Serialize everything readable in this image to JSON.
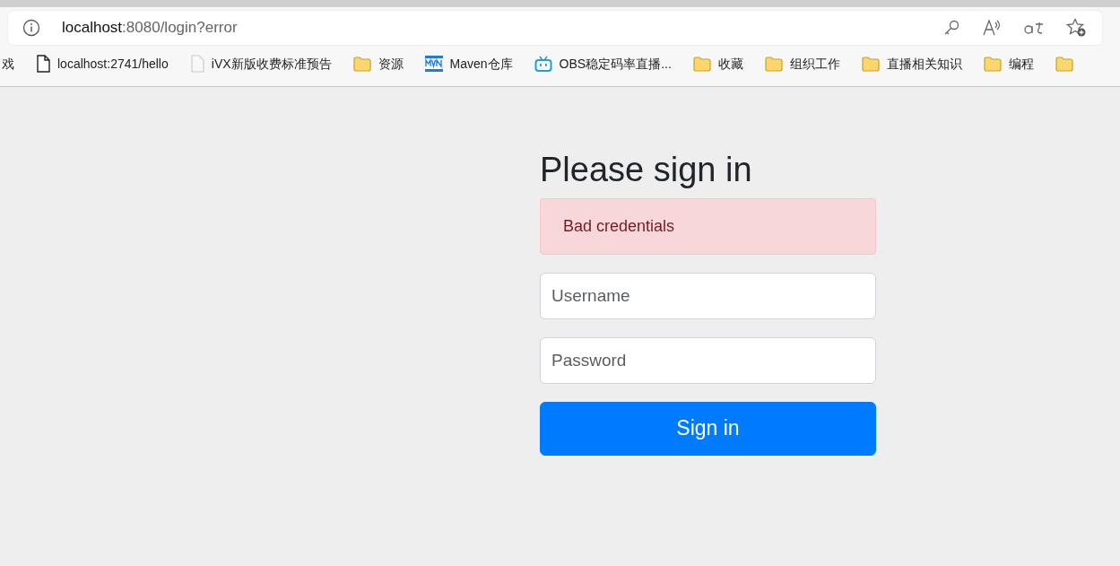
{
  "address_bar": {
    "host": "localhost",
    "path": ":8080/login?error"
  },
  "bookmarks": [
    {
      "kind": "text",
      "label": "戏"
    },
    {
      "kind": "page",
      "label": "localhost:2741/hello"
    },
    {
      "kind": "blank",
      "label": "iVX新版收费标准预告"
    },
    {
      "kind": "folder",
      "label": "资源"
    },
    {
      "kind": "maven",
      "label": "Maven仓库"
    },
    {
      "kind": "tv",
      "label": "OBS稳定码率直播..."
    },
    {
      "kind": "folder",
      "label": "收藏"
    },
    {
      "kind": "folder",
      "label": "组织工作"
    },
    {
      "kind": "folder",
      "label": "直播相关知识"
    },
    {
      "kind": "folder",
      "label": "编程"
    },
    {
      "kind": "folder"
    }
  ],
  "form": {
    "heading": "Please sign in",
    "alert": "Bad credentials",
    "username": {
      "placeholder": "Username"
    },
    "password": {
      "placeholder": "Password"
    },
    "submit": "Sign in"
  }
}
